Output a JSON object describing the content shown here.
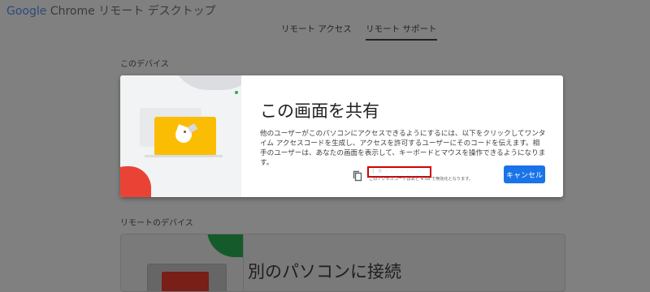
{
  "brand": {
    "google": "Google",
    "chrome": "Chrome",
    "title_rest": "リモート デスクトップ"
  },
  "tabs": [
    {
      "label": "リモート アクセス"
    },
    {
      "label": "リモート サポート"
    }
  ],
  "sections": {
    "this_device": "このデバイス",
    "remote_devices": "リモートのデバイス"
  },
  "modal": {
    "title": "この画面を共有",
    "description": "他のユーザーがこのパソコンにアクセスできるようにするには、以下をクリックしてワンタイム アクセスコードを生成し、アクセスを許可するユーザーにそのコードを伝えます。相手のユーザーは、あなたの画面を表示して、キーボードとマウスを操作できるようになります。",
    "access_code": "1 8 · ·   · ·   · · ·",
    "code_note": "このアクセスコードはあと 4:58 で無効化となります。",
    "cancel_label": "キャンセル",
    "copy_icon": "copy-icon"
  },
  "background_card": {
    "title": "別のパソコンに接続"
  },
  "colors": {
    "overlay": "#808080",
    "accent_blue": "#1a73e8",
    "yellow": "#fbbc04",
    "red": "#ea4335",
    "green": "#34a853",
    "highlight_red": "#d40000"
  }
}
